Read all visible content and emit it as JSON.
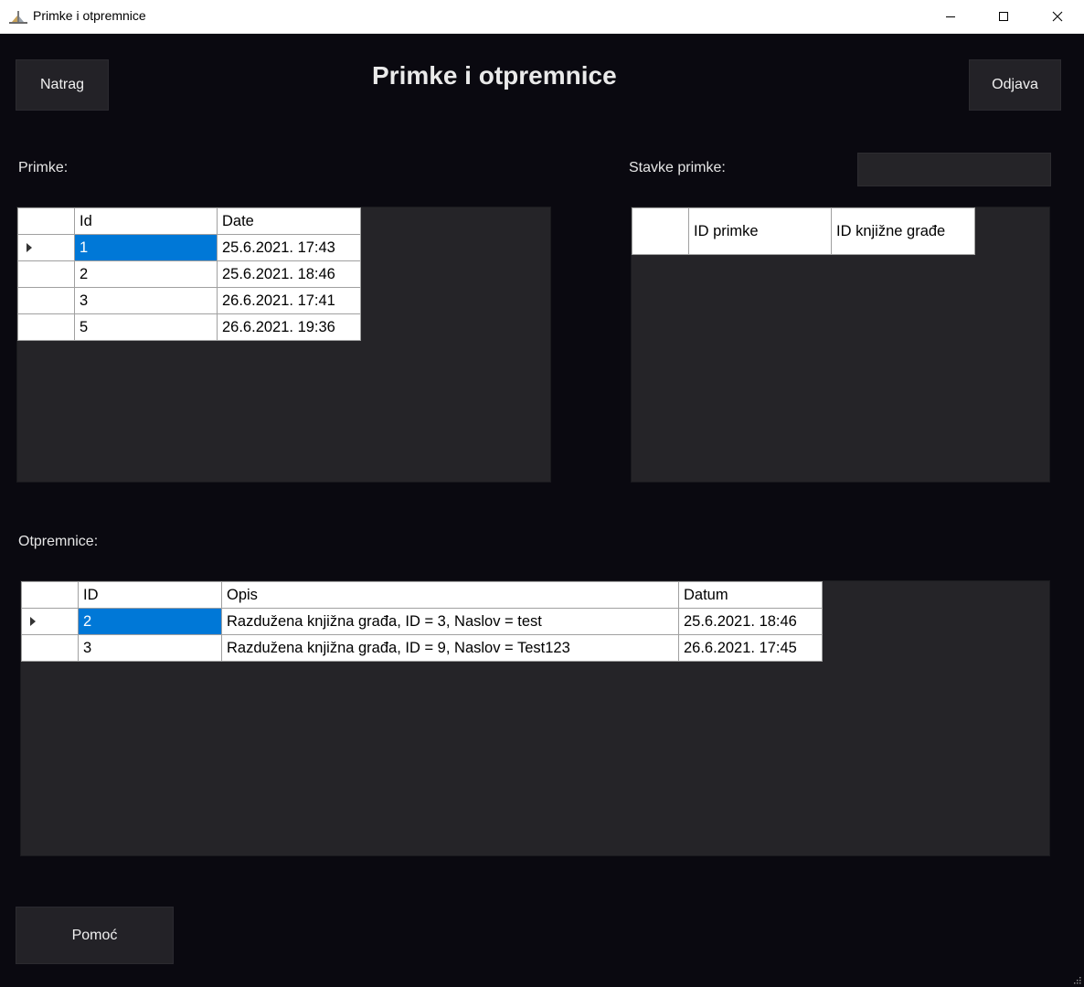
{
  "window": {
    "title": "Primke i otpremnice"
  },
  "header": {
    "back_label": "Natrag",
    "heading": "Primke i otpremnice",
    "logout_label": "Odjava"
  },
  "primke": {
    "label": "Primke:",
    "columns": [
      "Id",
      "Date"
    ],
    "rows": [
      [
        "1",
        "25.6.2021. 17:43"
      ],
      [
        "2",
        "25.6.2021. 18:46"
      ],
      [
        "3",
        "26.6.2021. 17:41"
      ],
      [
        "5",
        "26.6.2021. 19:36"
      ]
    ]
  },
  "stavke": {
    "label": "Stavke primke:",
    "input_value": "",
    "columns": [
      "ID primke",
      "ID knjižne građe"
    ]
  },
  "otpremnice": {
    "label": "Otpremnice:",
    "columns": [
      "ID",
      "Opis",
      "Datum"
    ],
    "rows": [
      [
        "2",
        "Razdužena knjižna građa, ID = 3, Naslov = test",
        "25.6.2021. 18:46"
      ],
      [
        "3",
        "Razdužena knjižna građa, ID = 9, Naslov = Test123",
        "26.6.2021. 17:45"
      ]
    ]
  },
  "footer": {
    "help_label": "Pomoć"
  },
  "colors": {
    "background": "#0a0910",
    "panel": "#252428",
    "button": "#232227",
    "selection": "#0078d7"
  }
}
